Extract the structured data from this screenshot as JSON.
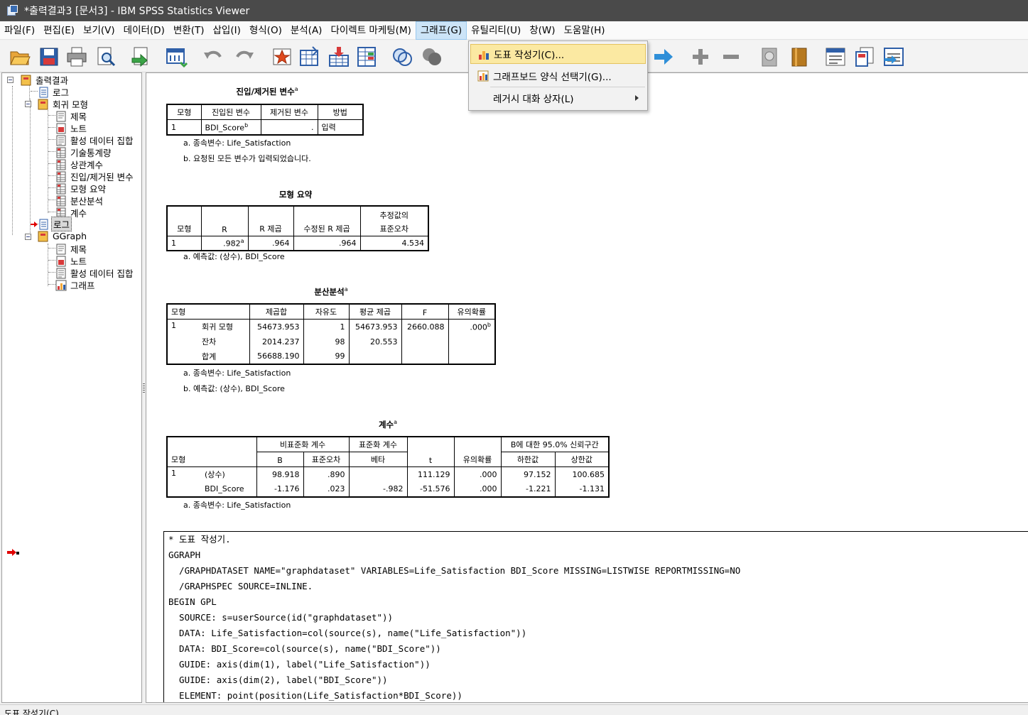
{
  "window": {
    "title": "*출력결과3 [문서3] - IBM SPSS Statistics Viewer"
  },
  "menubar": [
    {
      "label": "파일(F)"
    },
    {
      "label": "편집(E)"
    },
    {
      "label": "보기(V)"
    },
    {
      "label": "데이터(D)"
    },
    {
      "label": "변환(T)"
    },
    {
      "label": "삽입(I)"
    },
    {
      "label": "형식(O)"
    },
    {
      "label": "분석(A)"
    },
    {
      "label": "다이렉트 마케팅(M)"
    },
    {
      "label": "그래프(G)",
      "active": true
    },
    {
      "label": "유틸리티(U)"
    },
    {
      "label": "창(W)"
    },
    {
      "label": "도움말(H)"
    }
  ],
  "graph_menu": {
    "items": [
      {
        "label": "도표 작성기(C)...",
        "icon": "bar-chart-icon",
        "highlighted": true
      },
      {
        "label": "그래프보드 양식 선택기(G)...",
        "icon": "graphboard-icon"
      },
      {
        "label": "레거시 대화 상자(L)",
        "submenu": true
      }
    ]
  },
  "tree": {
    "root": "출력결과",
    "log1": "로그",
    "regression": {
      "label": "회귀 모형",
      "children": [
        "제목",
        "노트",
        "활성 데이터 집합",
        "기술통계량",
        "상관계수",
        "진입/제거된 변수",
        "모형 요약",
        "분산분석",
        "계수"
      ]
    },
    "log2": "로그",
    "ggraph": {
      "label": "GGraph",
      "children": [
        "제목",
        "노트",
        "활성 데이터 집합",
        "그래프"
      ]
    }
  },
  "entered_removed": {
    "title": "진입/제거된 변수",
    "sup": "a",
    "headers": [
      "모형",
      "진입된 변수",
      "제거된 변수",
      "방법"
    ],
    "row": {
      "model": "1",
      "entered": "BDI_Score",
      "entered_sup": "b",
      "removed": ".",
      "method": "입력"
    },
    "footnotes": [
      "a. 종속변수: Life_Satisfaction",
      "b. 요청된 모든 변수가 입력되었습니다."
    ]
  },
  "model_summary": {
    "title": "모형 요약",
    "headers": [
      "모형",
      "R",
      "R 제곱",
      "수정된 R 제곱",
      "추정값의",
      "표준오차"
    ],
    "row": {
      "model": "1",
      "r": ".982",
      "r_sup": "a",
      "r2": ".964",
      "adj_r2": ".964",
      "se": "4.534"
    },
    "footnotes": [
      "a. 예측값: (상수), BDI_Score"
    ]
  },
  "anova": {
    "title": "분산분석",
    "sup": "a",
    "headers": [
      "모형",
      "제곱합",
      "자유도",
      "평균 제곱",
      "F",
      "유의확률"
    ],
    "model": "1",
    "rows": [
      {
        "label": "회귀 모형",
        "ss": "54673.953",
        "df": "1",
        "ms": "54673.953",
        "f": "2660.088",
        "sig": ".000",
        "sig_sup": "b"
      },
      {
        "label": "잔차",
        "ss": "2014.237",
        "df": "98",
        "ms": "20.553",
        "f": "",
        "sig": ""
      },
      {
        "label": "합계",
        "ss": "56688.190",
        "df": "99",
        "ms": "",
        "f": "",
        "sig": ""
      }
    ],
    "footnotes": [
      "a. 종속변수: Life_Satisfaction",
      "b. 예측값: (상수), BDI_Score"
    ]
  },
  "coefficients": {
    "title": "계수",
    "sup": "a",
    "headers": {
      "model": "모형",
      "unstd": "비표준화 계수",
      "std": "표준화 계수",
      "t": "t",
      "sig": "유의확률",
      "ci": "B에 대한 95.0% 신뢰구간",
      "b": "B",
      "se": "표준오차",
      "beta": "베타",
      "lower": "하한값",
      "upper": "상한값"
    },
    "model": "1",
    "rows": [
      {
        "label": "(상수)",
        "b": "98.918",
        "se": ".890",
        "beta": "",
        "t": "111.129",
        "sig": ".000",
        "lower": "97.152",
        "upper": "100.685"
      },
      {
        "label": "BDI_Score",
        "b": "-1.176",
        "se": ".023",
        "beta": "-.982",
        "t": "-51.576",
        "sig": ".000",
        "lower": "-1.221",
        "upper": "-1.131"
      }
    ],
    "footnotes": [
      "a. 종속변수: Life_Satisfaction"
    ]
  },
  "syntax_log": [
    "* 도표 작성기.",
    "GGRAPH",
    "  /GRAPHDATASET NAME=\"graphdataset\" VARIABLES=Life_Satisfaction BDI_Score MISSING=LISTWISE REPORTMISSING=NO",
    "  /GRAPHSPEC SOURCE=INLINE.",
    "BEGIN GPL",
    "  SOURCE: s=userSource(id(\"graphdataset\"))",
    "  DATA: Life_Satisfaction=col(source(s), name(\"Life_Satisfaction\"))",
    "  DATA: BDI_Score=col(source(s), name(\"BDI_Score\"))",
    "  GUIDE: axis(dim(1), label(\"Life_Satisfaction\"))",
    "  GUIDE: axis(dim(2), label(\"BDI_Score\"))",
    "  ELEMENT: point(position(Life_Satisfaction*BDI_Score))"
  ],
  "statusbar": {
    "text": "도표 작성기(C)..."
  },
  "colors": {
    "titlebar": "#4a4a4a",
    "menu_active": "#cce4f7",
    "menu_hover": "#fbe9a2",
    "marker_red": "#e00000"
  }
}
